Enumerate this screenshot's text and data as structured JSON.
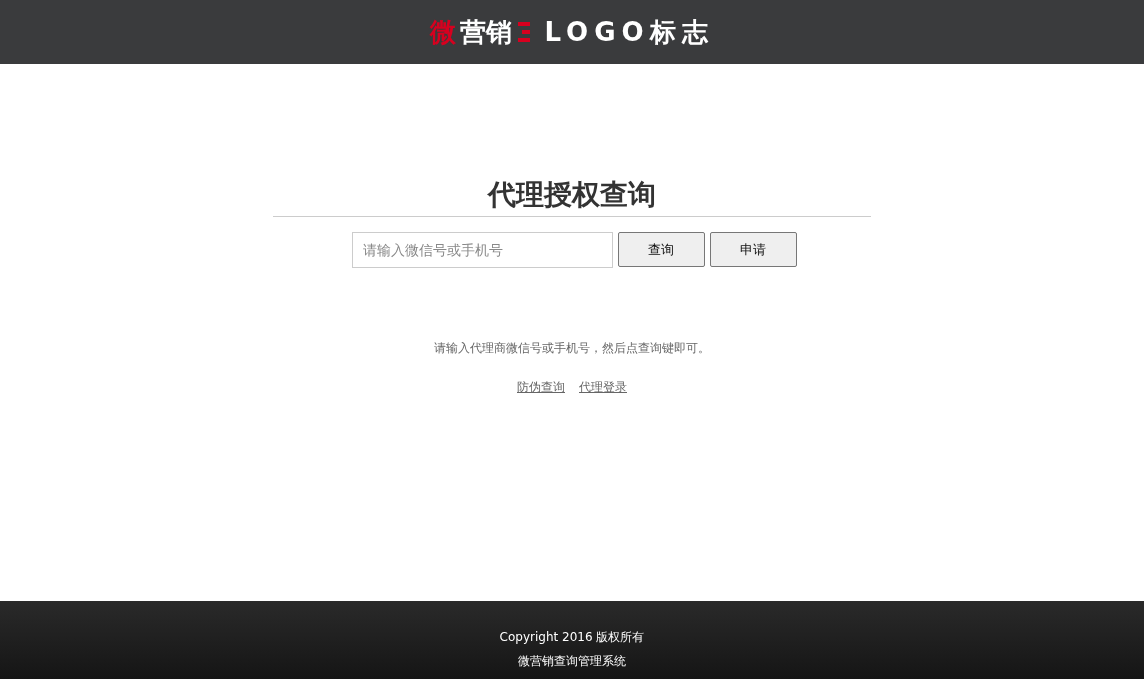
{
  "header": {
    "logo_parts": [
      {
        "text": "微",
        "color": "#d7001f"
      },
      {
        "text": "营销",
        "color": "#ffffff"
      }
    ],
    "logo_text": "LOGO标志"
  },
  "main": {
    "title": "代理授权查询",
    "search": {
      "placeholder": "请输入微信号或手机号"
    },
    "buttons": [
      "查询",
      "申请"
    ],
    "hint": "请输入代理商微信号或手机号，然后点查询键即可。",
    "links": [
      "防伪查询",
      "代理登录"
    ]
  },
  "footer": {
    "lines": [
      "Copyright 2016 版权所有",
      "微营销查询管理系统"
    ]
  }
}
